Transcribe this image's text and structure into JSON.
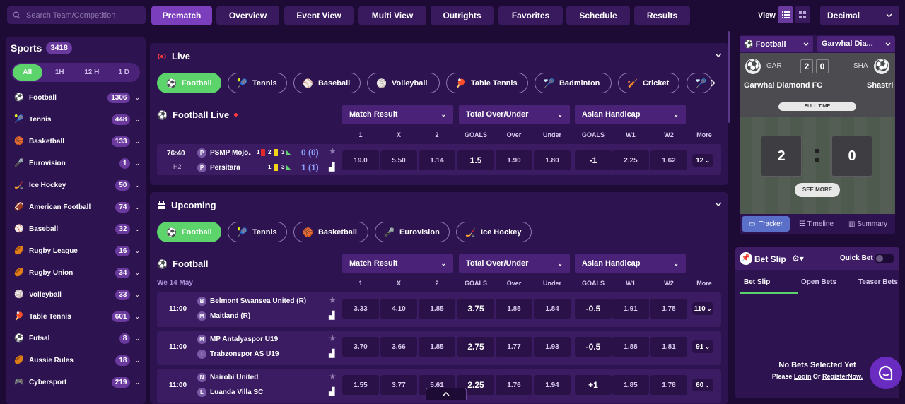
{
  "search": {
    "placeholder": "Search Team/Competition"
  },
  "nav": [
    {
      "label": "Prematch",
      "active": true
    },
    {
      "label": "Overview"
    },
    {
      "label": "Event View"
    },
    {
      "label": "Multi View"
    },
    {
      "label": "Outrights"
    },
    {
      "label": "Favorites"
    },
    {
      "label": "Schedule"
    },
    {
      "label": "Results"
    }
  ],
  "view_label": "View",
  "odds_format": "Decimal",
  "sidebar": {
    "title": "Sports",
    "count": "3418",
    "filters": [
      "All",
      "1H",
      "12 H",
      "1 D"
    ],
    "sports": [
      {
        "name": "Football",
        "count": "1306"
      },
      {
        "name": "Tennis",
        "count": "448"
      },
      {
        "name": "Basketball",
        "count": "133"
      },
      {
        "name": "Eurovision",
        "count": "1"
      },
      {
        "name": "Ice Hockey",
        "count": "50"
      },
      {
        "name": "American Football",
        "count": "74"
      },
      {
        "name": "Baseball",
        "count": "32"
      },
      {
        "name": "Rugby League",
        "count": "16"
      },
      {
        "name": "Rugby Union",
        "count": "34"
      },
      {
        "name": "Volleyball",
        "count": "33"
      },
      {
        "name": "Table Tennis",
        "count": "601"
      },
      {
        "name": "Futsal",
        "count": "8"
      },
      {
        "name": "Aussie Rules",
        "count": "18"
      },
      {
        "name": "Cybersport",
        "count": "219"
      }
    ]
  },
  "live": {
    "title": "Live",
    "sports": [
      "Football",
      "Tennis",
      "Baseball",
      "Volleyball",
      "Table Tennis",
      "Badminton",
      "Cricket"
    ],
    "section_title": "Football Live",
    "markets": [
      "Match Result",
      "Total Over/Under",
      "Asian Handicap"
    ],
    "cols": [
      "1",
      "X",
      "2",
      "GOALS",
      "Over",
      "Under",
      "GOALS",
      "W1",
      "W2",
      "More"
    ],
    "match": {
      "time": "76:40",
      "period": "H2",
      "home": {
        "badge": "P",
        "name": "PSMP Mojo...",
        "red": "1",
        "yellow": "2",
        "corners": "3",
        "score": "0",
        "ht": "(0)"
      },
      "away": {
        "badge": "P",
        "name": "Persitara",
        "red": "",
        "yellow": "1",
        "corners": "3",
        "score": "1",
        "ht": "(1)"
      },
      "odds": [
        "19.0",
        "5.50",
        "1.14",
        "1.5",
        "1.90",
        "1.80",
        "-1",
        "2.25",
        "1.62"
      ],
      "more": "12"
    }
  },
  "upcoming": {
    "title": "Upcoming",
    "sports": [
      "Football",
      "Tennis",
      "Basketball",
      "Eurovision",
      "Ice Hockey"
    ],
    "section_title": "Football",
    "date": "We 14 May",
    "markets": [
      "Match Result",
      "Total Over/Under",
      "Asian Handicap"
    ],
    "cols": [
      "1",
      "X",
      "2",
      "GOALS",
      "Over",
      "Under",
      "GOALS",
      "W1",
      "W2",
      "More"
    ],
    "matches": [
      {
        "time": "11:00",
        "home": {
          "badge": "B",
          "name": "Belmont Swansea United (R)"
        },
        "away": {
          "badge": "M",
          "name": "Maitland (R)"
        },
        "odds": [
          "3.33",
          "4.10",
          "1.85",
          "3.75",
          "1.85",
          "1.84",
          "-0.5",
          "1.91",
          "1.78"
        ],
        "more": "110"
      },
      {
        "time": "11:00",
        "home": {
          "badge": "M",
          "name": "MP Antalyaspor U19"
        },
        "away": {
          "badge": "T",
          "name": "Trabzonspor AS U19"
        },
        "odds": [
          "3.70",
          "3.66",
          "1.85",
          "2.75",
          "1.77",
          "1.93",
          "-0.5",
          "1.88",
          "1.81"
        ],
        "more": "91"
      },
      {
        "time": "11:00",
        "home": {
          "badge": "N",
          "name": "Nairobi United"
        },
        "away": {
          "badge": "L",
          "name": "Luanda Villa SC"
        },
        "odds": [
          "1.55",
          "3.77",
          "5.61",
          "2.25",
          "1.76",
          "1.94",
          "+1",
          "1.85",
          "1.78"
        ],
        "more": "60"
      }
    ]
  },
  "tracker": {
    "sport": "Football",
    "match_select": "Garwhal Dia...",
    "home_abbr": "GAR",
    "away_abbr": "SHA",
    "home_score": "2",
    "away_score": "0",
    "home_name": "Garwhal Diamond FC",
    "away_name": "Shastri",
    "status": "FULL TIME",
    "see_more": "SEE MORE",
    "tabs": [
      "Tracker",
      "Timeline",
      "Summary"
    ]
  },
  "betslip": {
    "title": "Bet Slip",
    "quick_bet": "Quick Bet",
    "tabs": [
      "Bet Slip",
      "Open Bets",
      "Teaser Bets"
    ],
    "empty": "No Bets Selected Yet",
    "please": "Please",
    "login": "Login",
    "or": "Or",
    "register": "RegisterNow."
  }
}
